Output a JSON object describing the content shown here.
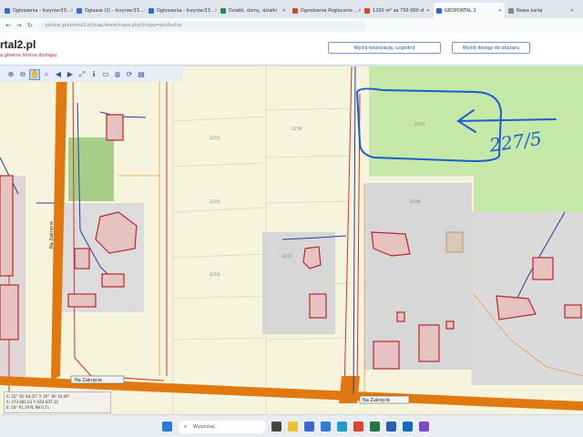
{
  "tabs": [
    {
      "label": "Ogłoszenia - Inzynier33...",
      "color": "#3c6ac8"
    },
    {
      "label": "Oglasza (2) - Inzynier33...",
      "color": "#3c6ac8"
    },
    {
      "label": "Ogłoszenia - Inzynier33...",
      "color": "#3c6ac8"
    },
    {
      "label": "Działki, domy, działki",
      "color": "#2a8a4a"
    },
    {
      "label": "Ogrodzenie Pogłocznie ...",
      "color": "#d04a2a"
    },
    {
      "label": "1200 m² za 750 000 zł",
      "color": "#d04a2a"
    },
    {
      "label": "GEOPORTAL 2",
      "color": "#2a6ad0",
      "active": true
    },
    {
      "label": "Nowa karta",
      "color": "#888888"
    }
  ],
  "address": {
    "url": "polska.geoportal2.pl/map/www/mapa.php?mapa=podlaskie"
  },
  "site": {
    "logo": "rtal2.pl",
    "subtitle": "a główna   Strona dostępu",
    "button_send": "Wyślij lokalizację, uzgodnij",
    "button_exit": "Wyślij dostęp do obszaru"
  },
  "toolbar": {
    "icons": [
      "zoom-in-icon",
      "zoom-out-icon",
      "pan-hand-icon",
      "zoom-window-icon",
      "arrow-left-icon",
      "arrow-right-icon",
      "measure-icon",
      "info-icon",
      "ruler-icon",
      "globe-icon",
      "refresh-icon",
      "layers-icon"
    ]
  },
  "map": {
    "annotation": "227/5",
    "street_labels": [
      "Na Zakręcie",
      "Na Zakręcie",
      "Na Zakręcie"
    ],
    "colors": {
      "road_fill": "#e07a10",
      "parcel_line": "#d93030",
      "utility_line": "#2a3aa0",
      "background": "#f6f4dc",
      "green": "#c6e8a8",
      "gray": "#d7d7d7",
      "annotation": "#1a5fd0"
    }
  },
  "coords": {
    "line1": "X: 52° 10' 44,25\"   Y: 20° 39' 10,69\"",
    "line2": "X: 473 481,63       Y: 654 837,12",
    "line3": "E: 18° 91,19        N: 98 0,71"
  },
  "taskbar": {
    "search_placeholder": "Wyszukaj",
    "icons": [
      "windows-start-icon",
      "task-view-icon",
      "file-explorer-icon",
      "store-icon",
      "mail-icon",
      "edge-icon",
      "chrome-icon",
      "excel-icon",
      "word-icon",
      "outlook-icon",
      "photos-icon",
      "app-icon"
    ]
  }
}
